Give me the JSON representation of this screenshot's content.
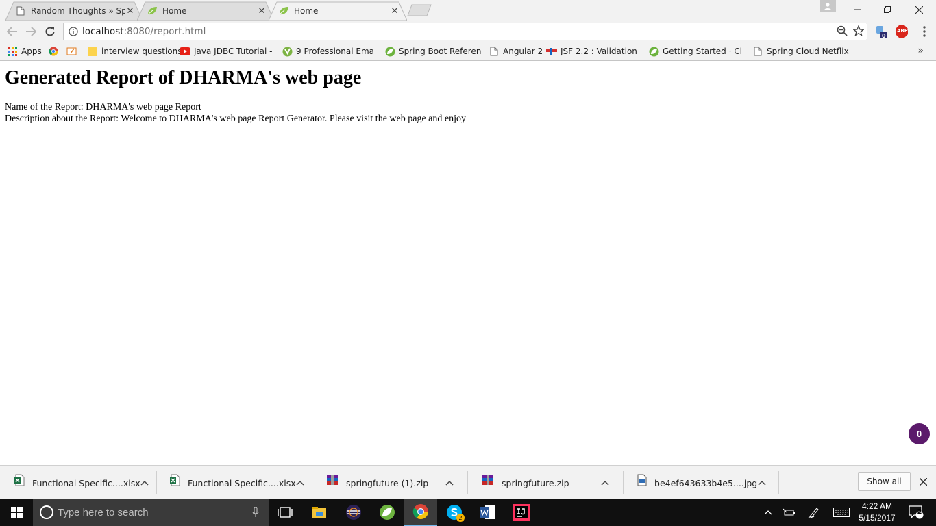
{
  "browser": {
    "tabs": [
      {
        "title": "Random Thoughts » Spri",
        "active": false
      },
      {
        "title": "Home",
        "active": false
      },
      {
        "title": "Home",
        "active": true
      }
    ],
    "url": {
      "host": "localhost",
      "path": ":8080/report.html"
    },
    "extensions": {
      "badge_count": "0",
      "abp_label": "ABP"
    },
    "bookmarks": [
      {
        "label": "Apps",
        "icon": "apps-grid-icon"
      },
      {
        "label": "",
        "icon": "chrome-icon"
      },
      {
        "label": "",
        "icon": "edit-icon"
      },
      {
        "label": "interview questions",
        "icon": "folder-icon"
      },
      {
        "label": "Java JDBC Tutorial - P",
        "icon": "youtube-icon"
      },
      {
        "label": "9 Professional Email S",
        "icon": "yoast-icon"
      },
      {
        "label": "Spring Boot Reference",
        "icon": "spring-icon"
      },
      {
        "label": "Angular 2",
        "icon": "page-icon"
      },
      {
        "label": "JSF 2.2 : Validation in",
        "icon": "jsf-icon"
      },
      {
        "label": "Getting Started · Clien",
        "icon": "spring-icon"
      },
      {
        "label": "Spring Cloud Netflix",
        "icon": "page-icon"
      }
    ],
    "bookmarks_overflow": "»"
  },
  "page": {
    "heading": "Generated Report of DHARMA's web page",
    "lines": [
      "Name of the Report: DHARMA's web page Report",
      "Description about the Report: Welcome to DHARMA's web page Report Generator. Please visit the web page and enjoy"
    ],
    "badge_count": "0"
  },
  "downloads": {
    "items": [
      {
        "name": "Functional Specific....xlsx",
        "icon": "excel-file-icon"
      },
      {
        "name": "Functional Specific....xlsx",
        "icon": "excel-file-icon"
      },
      {
        "name": "springfuture (1).zip",
        "icon": "winrar-archive-icon"
      },
      {
        "name": "springfuture.zip",
        "icon": "winrar-archive-icon"
      },
      {
        "name": "be4ef643633b4e5....jpg",
        "icon": "image-file-icon"
      }
    ],
    "show_all_label": "Show all"
  },
  "taskbar": {
    "search_placeholder": "Type here to search",
    "apps": [
      {
        "name": "task-view-icon"
      },
      {
        "name": "file-explorer-icon"
      },
      {
        "name": "eclipse-icon"
      },
      {
        "name": "spring-tool-suite-icon"
      },
      {
        "name": "chrome-icon"
      },
      {
        "name": "skype-icon"
      },
      {
        "name": "word-icon"
      },
      {
        "name": "intellij-icon"
      }
    ],
    "skype_badge": "2",
    "time": "4:22 AM",
    "date": "5/15/2017",
    "notification_count": "2"
  }
}
